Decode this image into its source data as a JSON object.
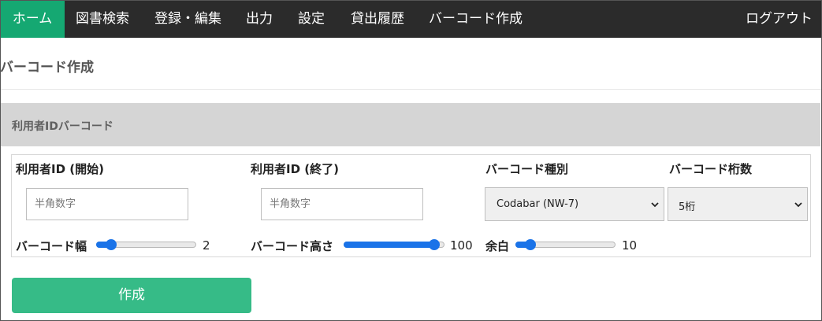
{
  "nav": {
    "items": [
      {
        "label": "ホーム",
        "active": true
      },
      {
        "label": "図書検索"
      },
      {
        "label": "登録・編集"
      },
      {
        "label": "出力"
      },
      {
        "label": "設定"
      },
      {
        "label": "貸出履歴"
      },
      {
        "label": "バーコード作成"
      }
    ],
    "logout": "ログアウト"
  },
  "page": {
    "title": "バーコード作成"
  },
  "section": {
    "title": "利用者IDバーコード"
  },
  "form": {
    "start_label": "利用者ID (開始)",
    "start_placeholder": "半角数字",
    "end_label": "利用者ID (終了)",
    "end_placeholder": "半角数字",
    "type_label": "バーコード種別",
    "type_value": "Codabar (NW-7)",
    "digits_label": "バーコード桁数",
    "digits_value": "5桁",
    "width_label": "バーコード幅",
    "width_value": "2",
    "width_fraction": 0.11,
    "height_label": "バーコード高さ",
    "height_value": "100",
    "height_fraction": 0.95,
    "margin_label": "余白",
    "margin_value": "10",
    "margin_fraction": 0.11,
    "create_label": "作成"
  },
  "colors": {
    "nav_bg": "#2b2b2b",
    "nav_active": "#15a872",
    "accent": "#1a73e8",
    "button": "#36bb87"
  }
}
